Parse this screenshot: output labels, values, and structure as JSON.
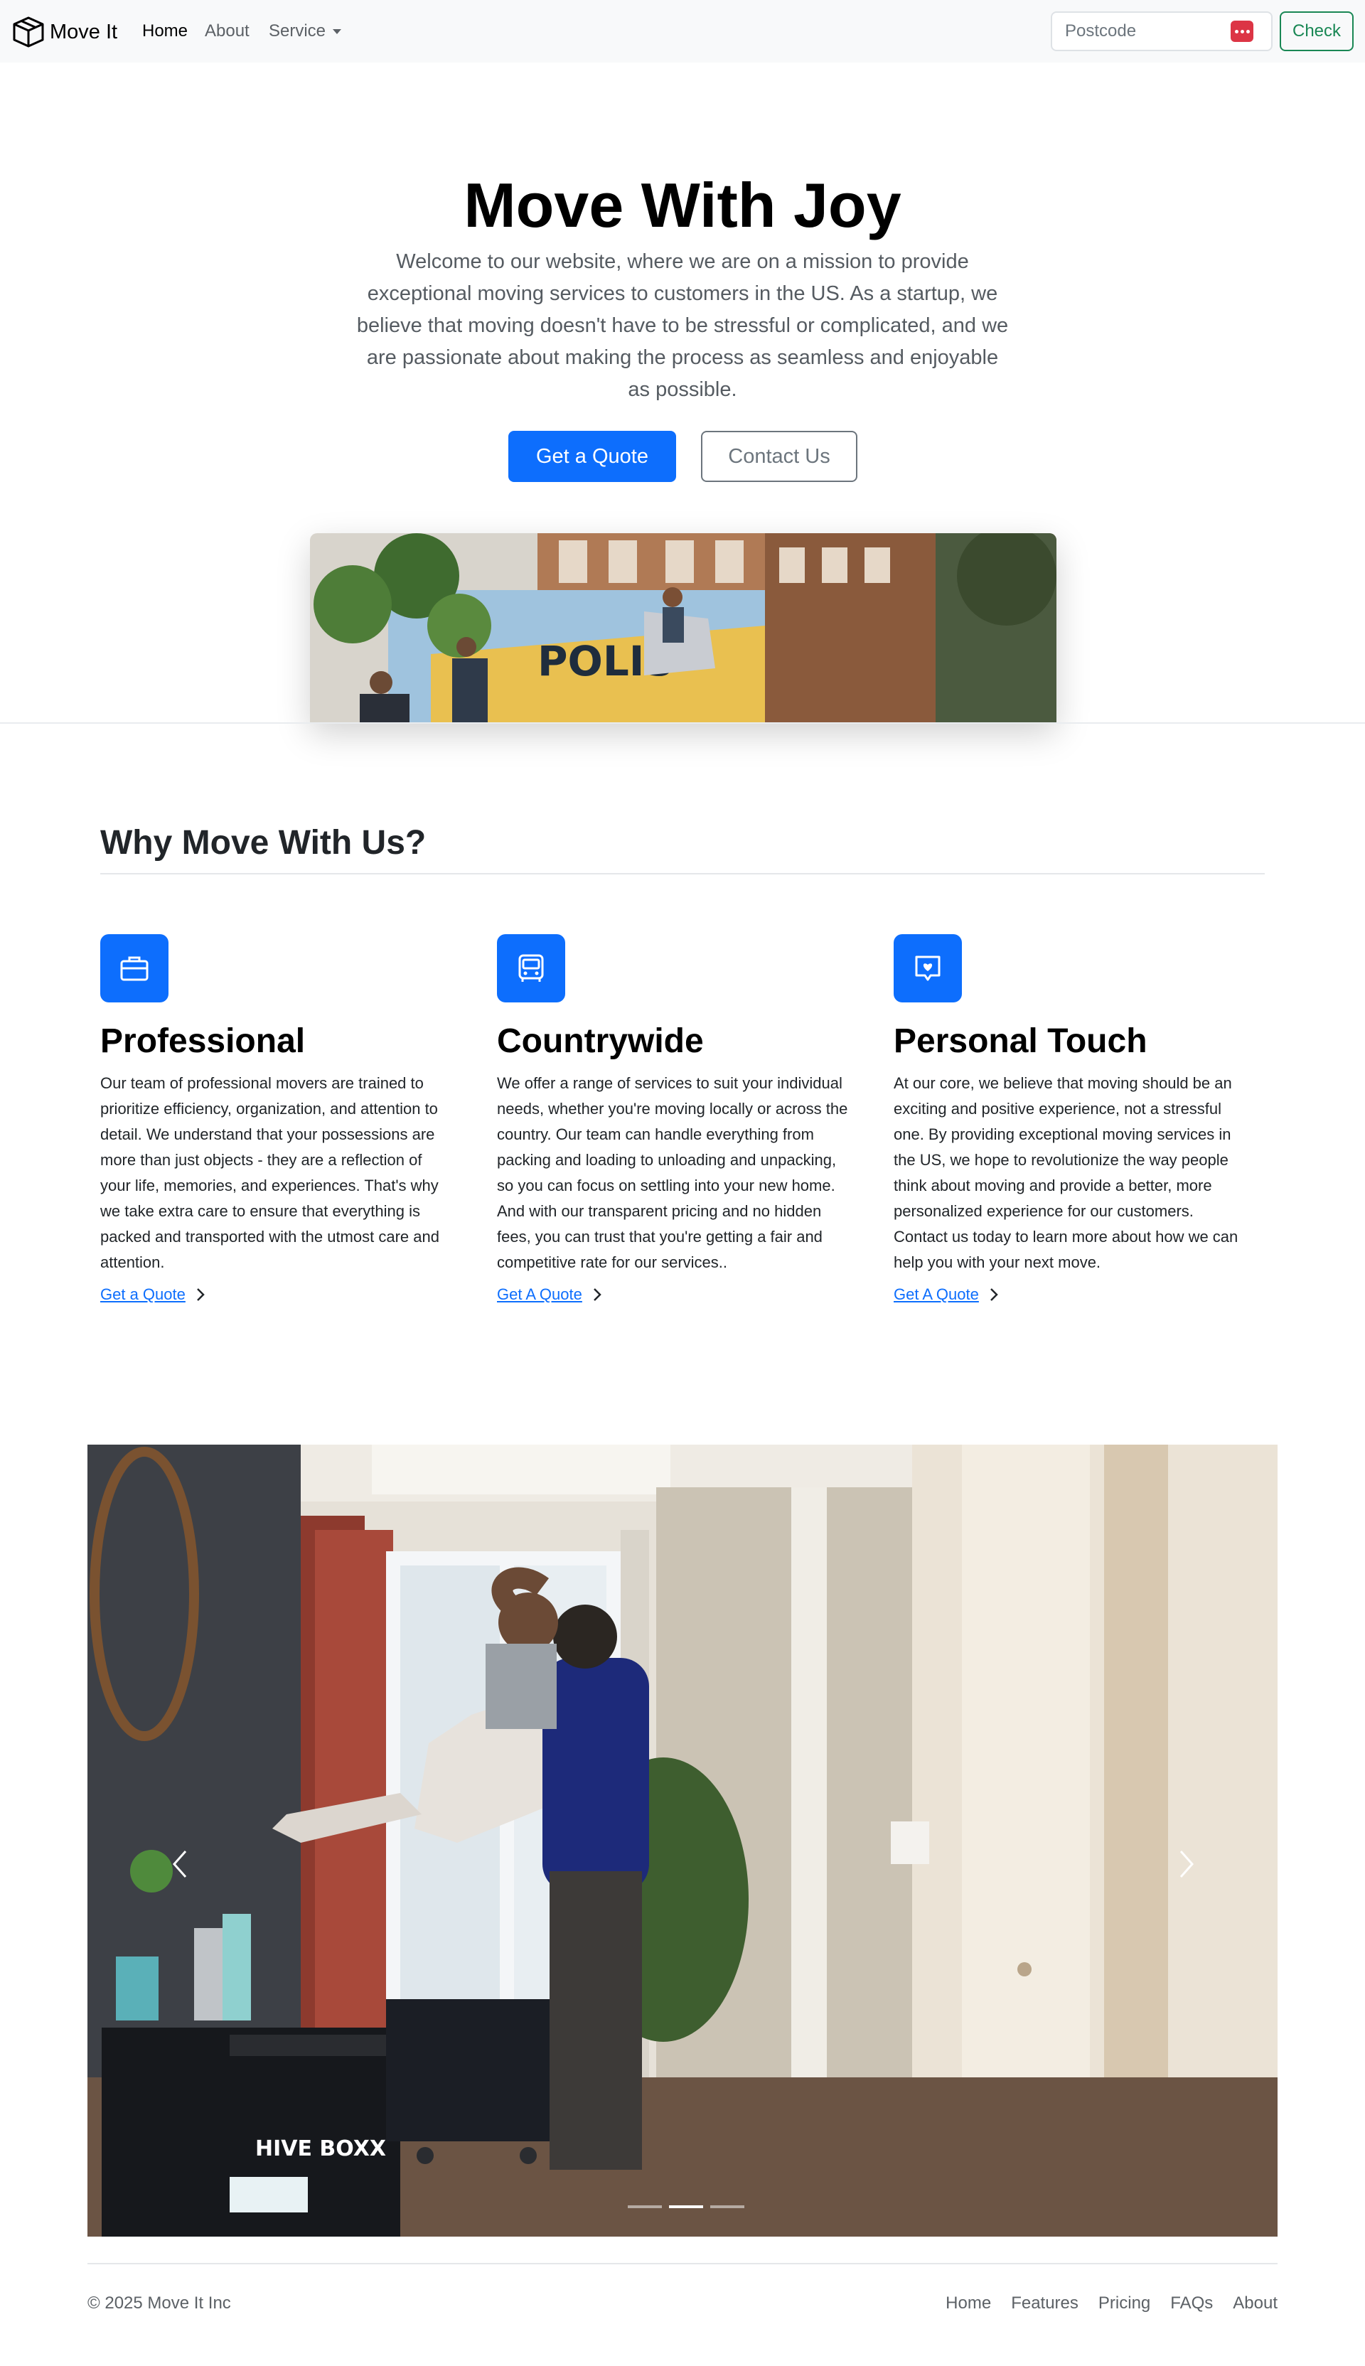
{
  "navbar": {
    "brand": "Move It",
    "links": [
      {
        "label": "Home",
        "active": true
      },
      {
        "label": "About",
        "active": false
      },
      {
        "label": "Service",
        "active": false
      }
    ],
    "postcode_placeholder": "Postcode",
    "check_label": "Check"
  },
  "hero": {
    "title": "Move With Joy",
    "lead": "Welcome to our website, where we are on a mission to provide exceptional moving services to customers in the US. As a startup, we believe that moving doesn't have to be stressful or complicated, and we are passionate about making the process as seamless and enjoyable as possible.",
    "primary_button": "Get a Quote",
    "secondary_button": "Contact Us",
    "image_truck_text": "POLIS"
  },
  "features": {
    "title": "Why Move With Us?",
    "items": [
      {
        "icon": "briefcase-icon",
        "title": "Professional",
        "text": "Our team of professional movers are trained to prioritize efficiency, organization, and attention to detail. We understand that your possessions are more than just objects - they are a reflection of your life, memories, and experiences. That's why we take extra care to ensure that everything is packed and transported with the utmost care and attention.",
        "link": "Get a Quote"
      },
      {
        "icon": "bus-icon",
        "title": "Countrywide",
        "text": "We offer a range of services to suit your individual needs, whether you're moving locally or across the country. Our team can handle everything from packing and loading to unloading and unpacking, so you can focus on settling into your new home. And with our transparent pricing and no hidden fees, you can trust that you're getting a fair and competitive rate for our services..",
        "link": "Get A Quote"
      },
      {
        "icon": "chat-heart-icon",
        "title": "Personal Touch",
        "text": "At our core, we believe that moving should be an exciting and positive experience, not a stressful one. By providing exceptional moving services in the US, we hope to revolutionize the way people think about moving and provide a better, more personalized experience for our customers. Contact us today to learn more about how we can help you with your next move.",
        "link": "Get A Quote"
      }
    ]
  },
  "carousel": {
    "box_brand": "HIVE BOXX",
    "active_slide": 2,
    "slide_count": 3
  },
  "footer": {
    "copyright": "© 2025 Move It Inc",
    "links": [
      "Home",
      "Features",
      "Pricing",
      "FAQs",
      "About"
    ]
  },
  "colors": {
    "primary": "#0d6efd",
    "success": "#198754",
    "danger": "#dc3545",
    "navbar_bg": "#f8f9fa"
  }
}
